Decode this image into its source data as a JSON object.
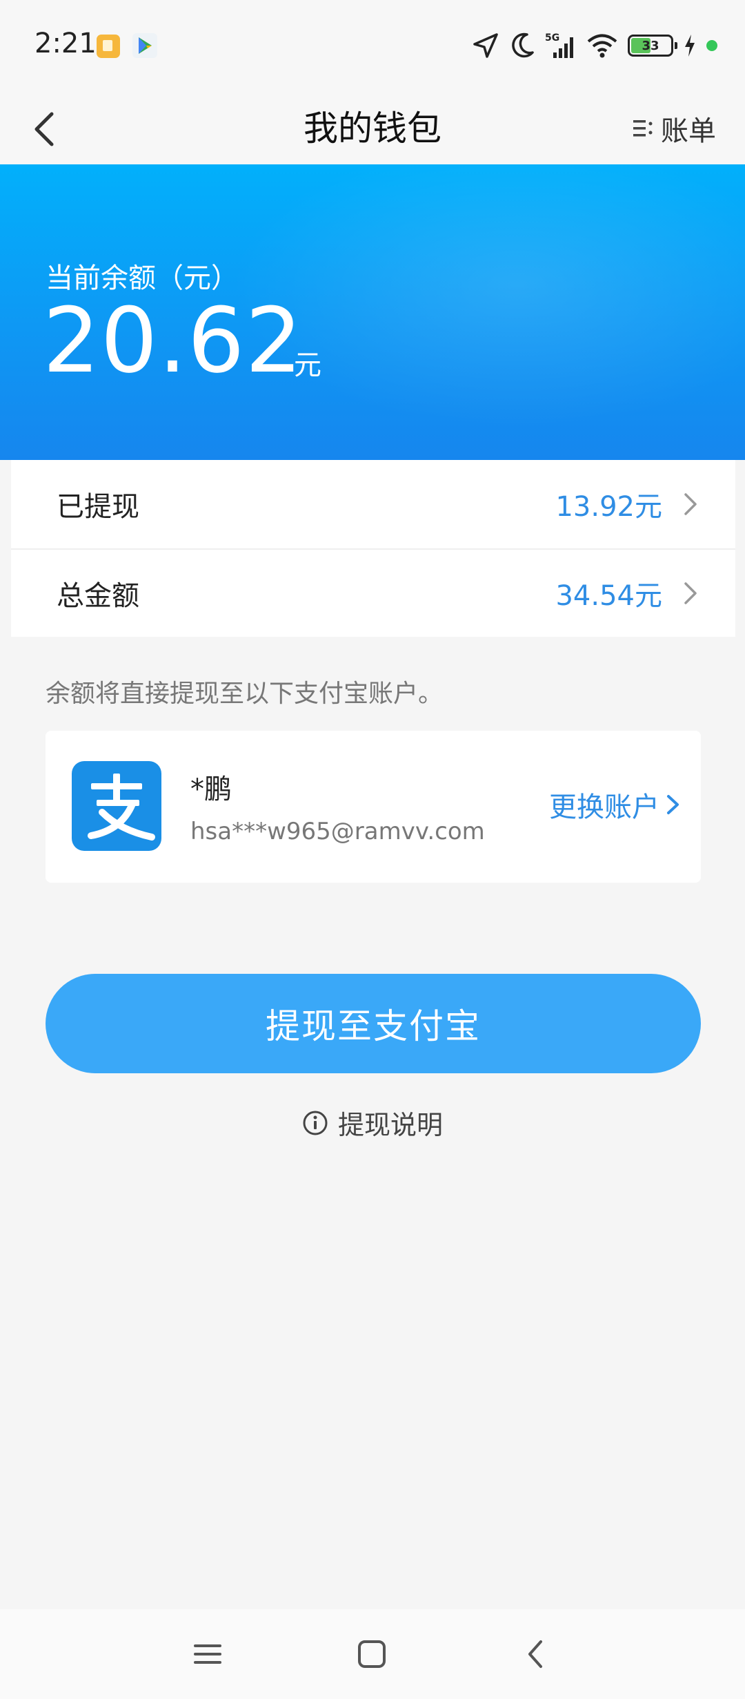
{
  "status_bar": {
    "time": "2:21",
    "network": "5G",
    "battery_level": "33",
    "icons": [
      "gallery-app-icon",
      "play-store-icon",
      "location-icon",
      "moon-icon",
      "signal-icon",
      "wifi-icon",
      "battery-icon",
      "charging-icon",
      "active-dot-icon"
    ]
  },
  "nav": {
    "title": "我的钱包",
    "bill_label": "账单",
    "back_icon": "back-arrow-icon",
    "bill_icon": "list-icon"
  },
  "balance": {
    "label": "当前余额（元）",
    "amount": "20.62",
    "unit": "元"
  },
  "rows": [
    {
      "label": "已提现",
      "value": "13.92元"
    },
    {
      "label": "总金额",
      "value": "34.54元"
    }
  ],
  "hint": "余额将直接提现至以下支付宝账户。",
  "account": {
    "logo_char": "支",
    "name": "*鹏",
    "email": "hsa***w965@ramvv.com",
    "change_label": "更换账户"
  },
  "withdraw_button": "提现至支付宝",
  "explain_label": "提现说明",
  "colors": {
    "banner_top": "#02b0fb",
    "banner_bottom": "#1686ee",
    "accent_text": "#2f8de4",
    "button": "#3aa8f8",
    "alipay": "#1a8fe6"
  },
  "system_nav": [
    "menu-icon",
    "home-icon",
    "back-icon"
  ]
}
